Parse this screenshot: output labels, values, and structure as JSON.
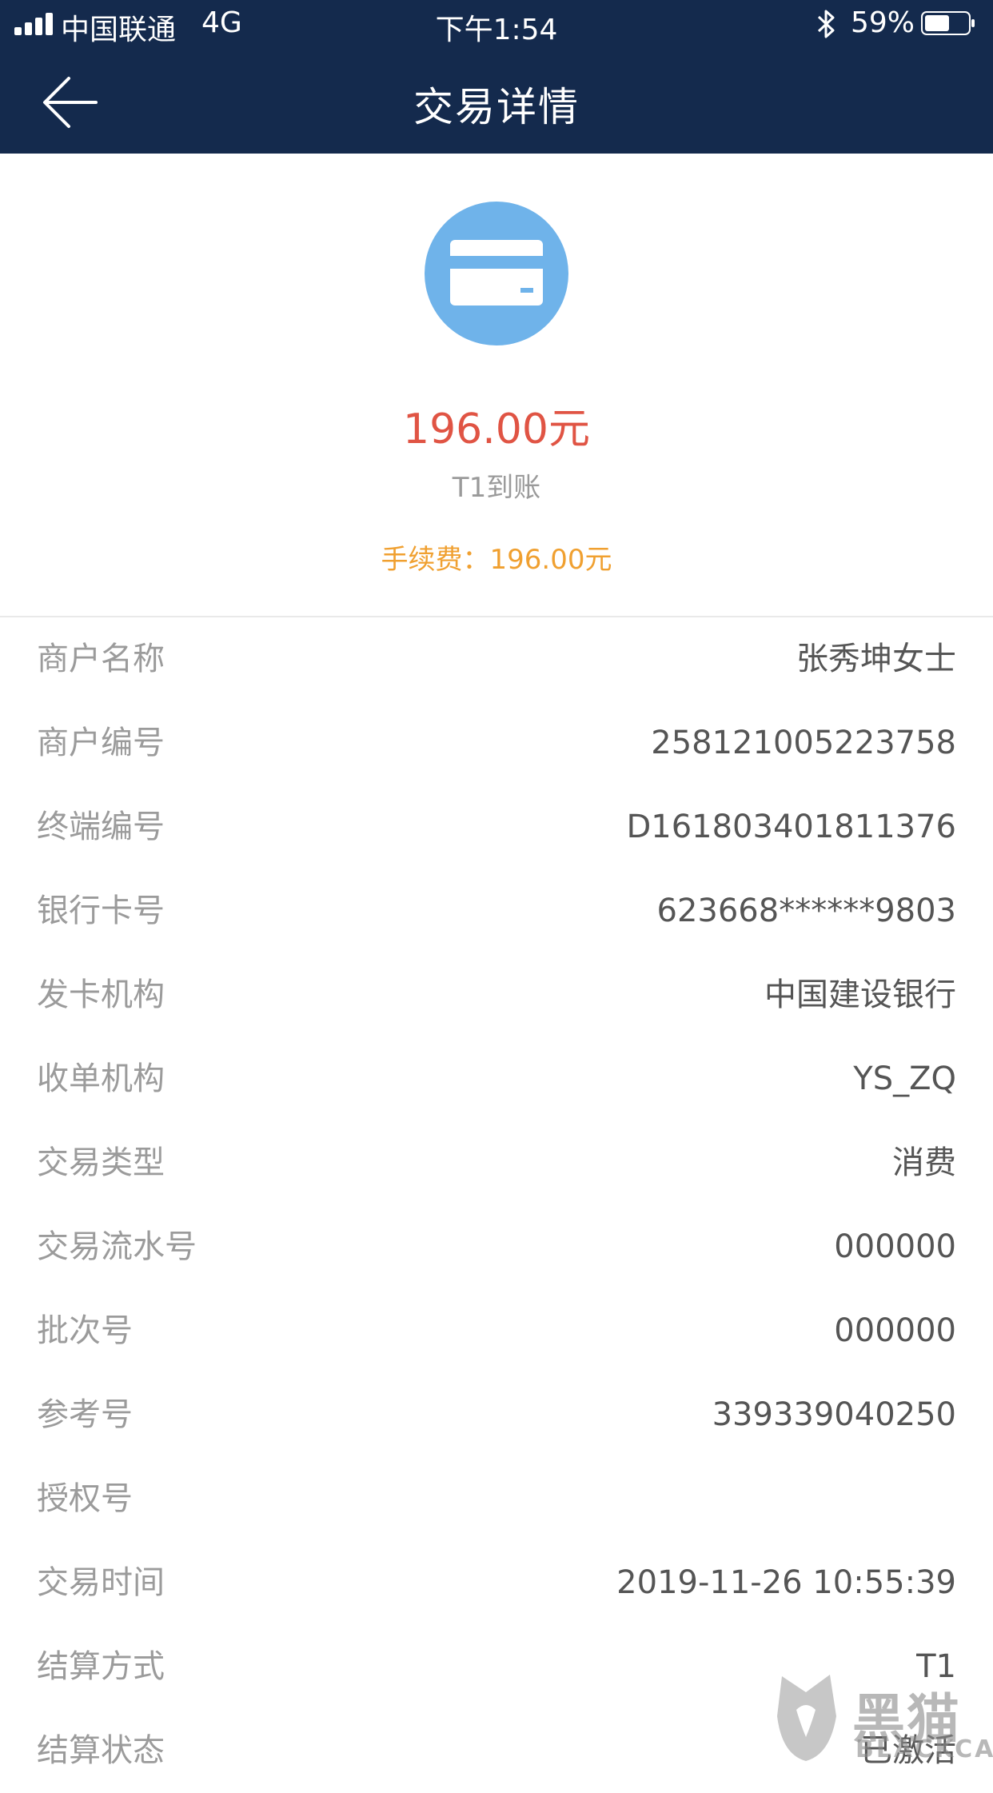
{
  "status_bar": {
    "carrier": "中国联通",
    "network": "4G",
    "time": "下午1:54",
    "battery": "59%"
  },
  "nav": {
    "title": "交易详情",
    "back_icon": "arrow-left-icon"
  },
  "summary": {
    "icon": "credit-card-icon",
    "amount": "196.00元",
    "settle_tag": "T1到账",
    "fee_label": "手续费：",
    "fee_value": "196.00元"
  },
  "details": [
    {
      "label": "商户名称",
      "value": "张秀坤女士"
    },
    {
      "label": "商户编号",
      "value": "258121005223758"
    },
    {
      "label": "终端编号",
      "value": "D161803401811376"
    },
    {
      "label": "银行卡号",
      "value": "623668******9803"
    },
    {
      "label": "发卡机构",
      "value": "中国建设银行"
    },
    {
      "label": "收单机构",
      "value": "YS_ZQ"
    },
    {
      "label": "交易类型",
      "value": "消费"
    },
    {
      "label": "交易流水号",
      "value": "000000"
    },
    {
      "label": "批次号",
      "value": "000000"
    },
    {
      "label": "参考号",
      "value": "339339040250"
    },
    {
      "label": "授权号",
      "value": ""
    },
    {
      "label": "交易时间",
      "value": "2019-11-26 10:55:39"
    },
    {
      "label": "结算方式",
      "value": "T1"
    },
    {
      "label": "结算状态",
      "value": "已激活"
    }
  ],
  "watermark": {
    "text": "黑猫",
    "sub": "BLACKCAT"
  },
  "colors": {
    "header_bg": "#142a4d",
    "amount": "#e05444",
    "fee": "#f0a030",
    "icon_circle": "#6fb3ea"
  }
}
